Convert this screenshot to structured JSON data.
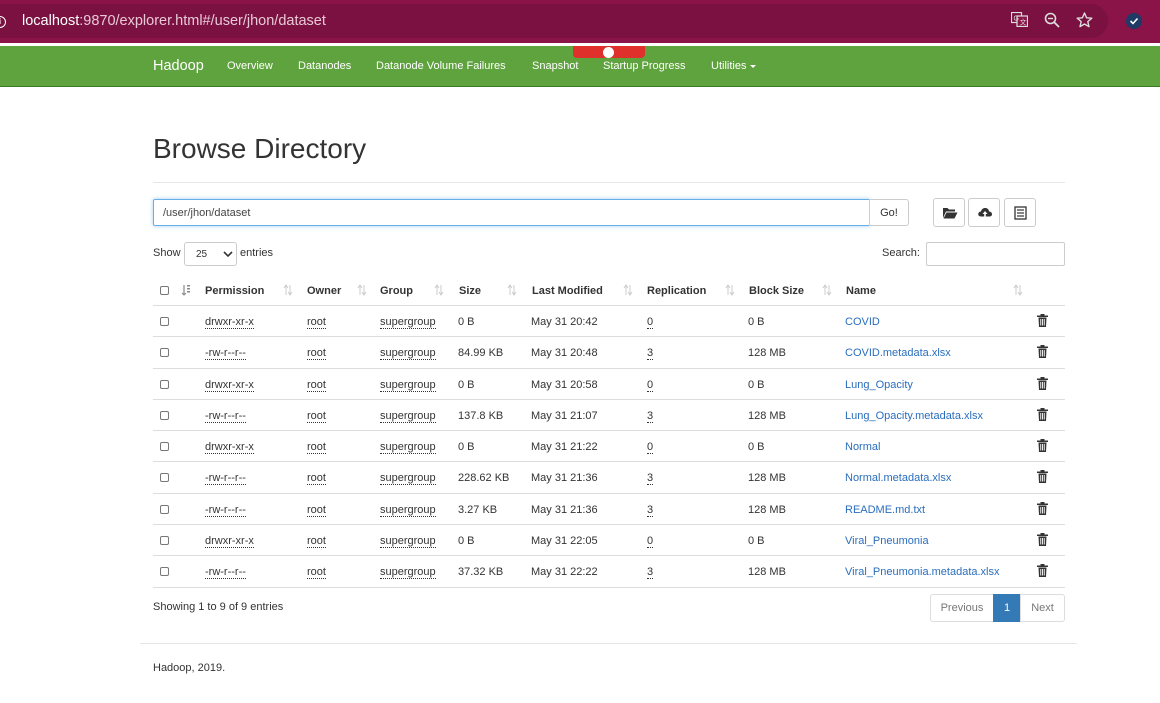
{
  "browser": {
    "url_host": "localhost",
    "url_rest": ":9870/explorer.html#/user/jhon/dataset"
  },
  "navbar": {
    "brand": "Hadoop",
    "items": [
      {
        "label": "Overview"
      },
      {
        "label": "Datanodes"
      },
      {
        "label": "Datanode Volume Failures"
      },
      {
        "label": "Snapshot"
      },
      {
        "label": "Startup Progress"
      },
      {
        "label": "Utilities"
      }
    ]
  },
  "page": {
    "title": "Browse Directory",
    "path_value": "/user/jhon/dataset",
    "go_label": "Go!",
    "show_label": "Show",
    "entries_value": "25",
    "entries_label": "entries",
    "search_label": "Search:"
  },
  "table": {
    "headers": [
      "Permission",
      "Owner",
      "Group",
      "Size",
      "Last Modified",
      "Replication",
      "Block Size",
      "Name"
    ],
    "rows": [
      {
        "permission": "drwxr-xr-x",
        "owner": "root",
        "group": "supergroup",
        "size": "0 B",
        "modified": "May 31 20:42",
        "replication": "0",
        "block_size": "0 B",
        "name": "COVID"
      },
      {
        "permission": "-rw-r--r--",
        "owner": "root",
        "group": "supergroup",
        "size": "84.99 KB",
        "modified": "May 31 20:48",
        "replication": "3",
        "block_size": "128 MB",
        "name": "COVID.metadata.xlsx"
      },
      {
        "permission": "drwxr-xr-x",
        "owner": "root",
        "group": "supergroup",
        "size": "0 B",
        "modified": "May 31 20:58",
        "replication": "0",
        "block_size": "0 B",
        "name": "Lung_Opacity"
      },
      {
        "permission": "-rw-r--r--",
        "owner": "root",
        "group": "supergroup",
        "size": "137.8 KB",
        "modified": "May 31 21:07",
        "replication": "3",
        "block_size": "128 MB",
        "name": "Lung_Opacity.metadata.xlsx"
      },
      {
        "permission": "drwxr-xr-x",
        "owner": "root",
        "group": "supergroup",
        "size": "0 B",
        "modified": "May 31 21:22",
        "replication": "0",
        "block_size": "0 B",
        "name": "Normal"
      },
      {
        "permission": "-rw-r--r--",
        "owner": "root",
        "group": "supergroup",
        "size": "228.62 KB",
        "modified": "May 31 21:36",
        "replication": "3",
        "block_size": "128 MB",
        "name": "Normal.metadata.xlsx"
      },
      {
        "permission": "-rw-r--r--",
        "owner": "root",
        "group": "supergroup",
        "size": "3.27 KB",
        "modified": "May 31 21:36",
        "replication": "3",
        "block_size": "128 MB",
        "name": "README.md.txt"
      },
      {
        "permission": "drwxr-xr-x",
        "owner": "root",
        "group": "supergroup",
        "size": "0 B",
        "modified": "May 31 22:05",
        "replication": "0",
        "block_size": "0 B",
        "name": "Viral_Pneumonia"
      },
      {
        "permission": "-rw-r--r--",
        "owner": "root",
        "group": "supergroup",
        "size": "37.32 KB",
        "modified": "May 31 22:22",
        "replication": "3",
        "block_size": "128 MB",
        "name": "Viral_Pneumonia.metadata.xlsx"
      }
    ]
  },
  "footer_info": {
    "showing": "Showing 1 to 9 of 9 entries",
    "prev": "Previous",
    "current_page": "1",
    "next": "Next"
  },
  "footer": "Hadoop, 2019.",
  "colors": {
    "browser_bar": "#8a1347",
    "navbar": "#5fa33e",
    "link": "#2a6ebd",
    "active_page": "#337ab7"
  }
}
